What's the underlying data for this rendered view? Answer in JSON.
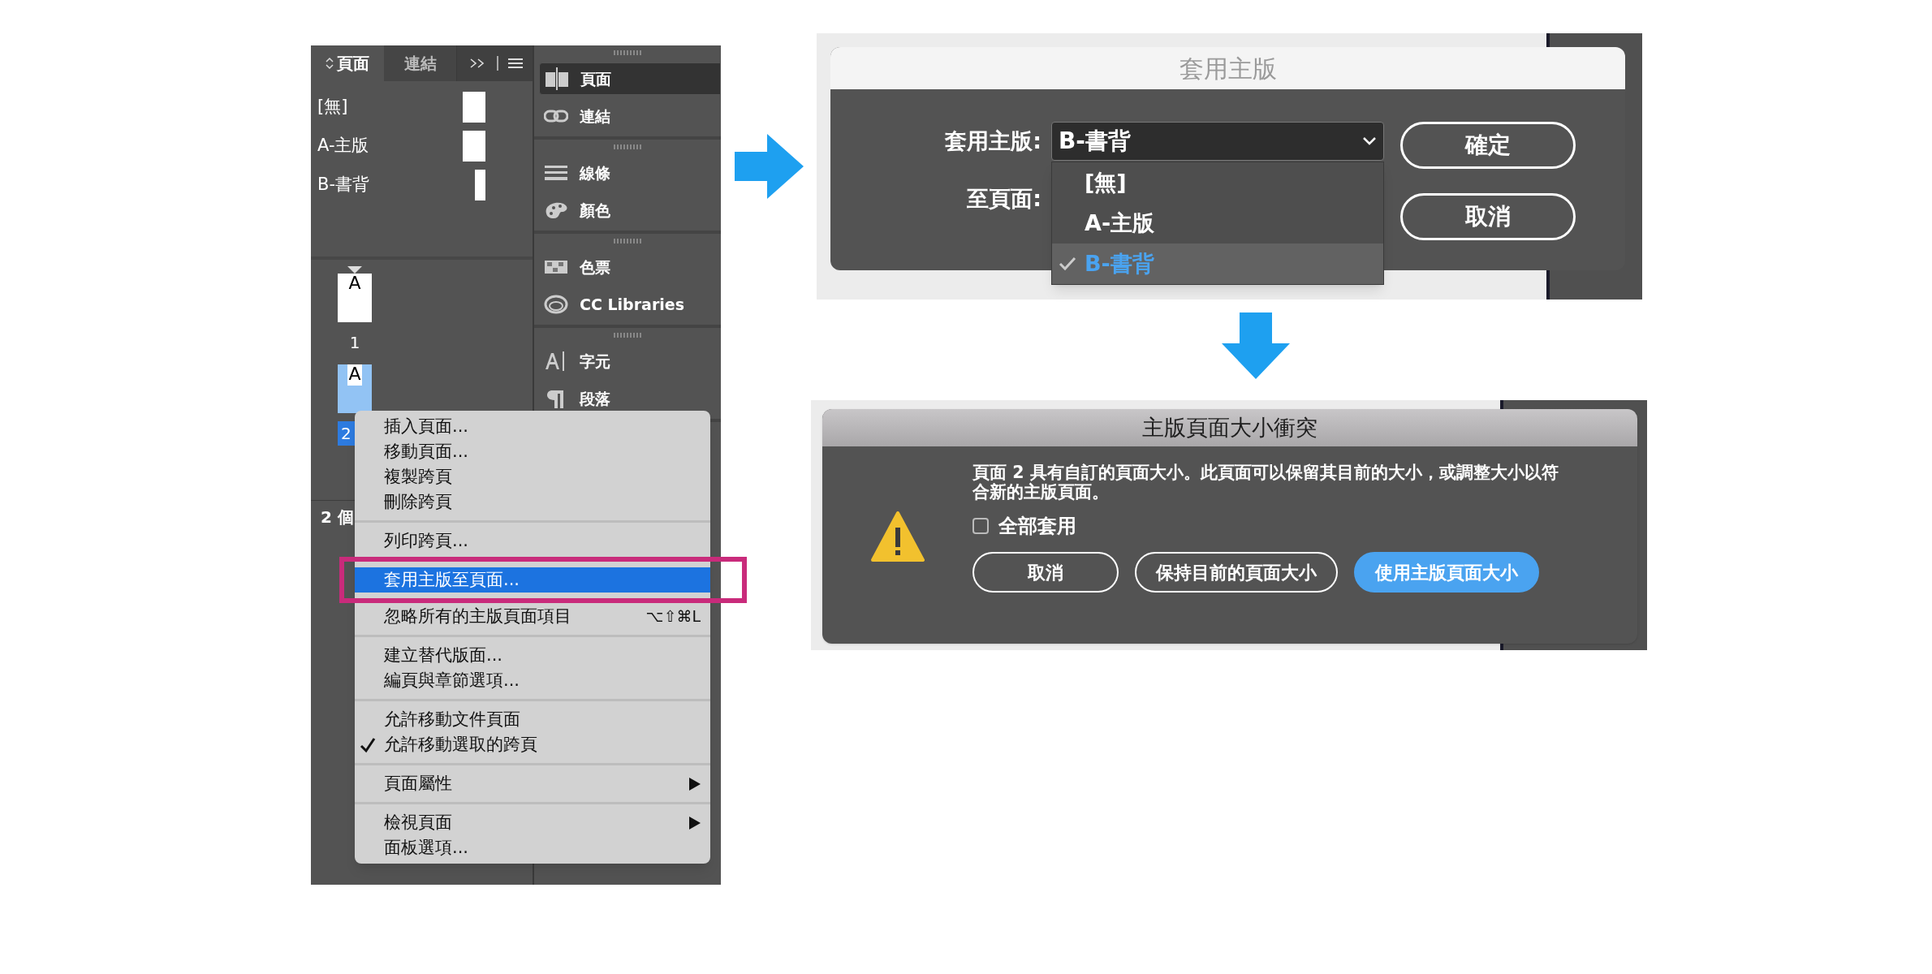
{
  "pages_panel": {
    "tabs": [
      {
        "label": "頁面",
        "selected": true
      },
      {
        "label": "連結",
        "selected": false
      }
    ],
    "masters": [
      {
        "label": "[無]",
        "kind": "page"
      },
      {
        "label": "A-主版",
        "kind": "page"
      },
      {
        "label": "B-書背",
        "kind": "spine"
      }
    ],
    "pages": [
      {
        "master": "A",
        "number": "1",
        "selected": false
      },
      {
        "master": "A",
        "number": "2",
        "selected": true
      }
    ],
    "status": "2 個"
  },
  "dock": {
    "groups": [
      [
        {
          "label": "頁面",
          "kind": "pages",
          "selected": true
        },
        {
          "label": "連結",
          "kind": "links",
          "selected": false
        }
      ],
      [
        {
          "label": "線條",
          "kind": "stroke",
          "selected": false
        },
        {
          "label": "顏色",
          "kind": "color",
          "selected": false
        }
      ],
      [
        {
          "label": "色票",
          "kind": "swatches",
          "selected": false
        },
        {
          "label": "CC Libraries",
          "kind": "cc",
          "selected": false
        }
      ],
      [
        {
          "label": "字元",
          "kind": "character",
          "selected": false
        },
        {
          "label": "段落",
          "kind": "paragraph",
          "selected": false
        }
      ]
    ]
  },
  "context_menu": {
    "sections": [
      [
        {
          "label": "插入頁面...",
          "checked": false,
          "submenu": false,
          "selected": false
        },
        {
          "label": "移動頁面...",
          "checked": false,
          "submenu": false,
          "selected": false
        },
        {
          "label": "複製跨頁",
          "checked": false,
          "submenu": false,
          "selected": false
        },
        {
          "label": "刪除跨頁",
          "checked": false,
          "submenu": false,
          "selected": false
        }
      ],
      [
        {
          "label": "列印跨頁...",
          "checked": false,
          "submenu": false,
          "selected": false
        }
      ],
      [
        {
          "label": "套用主版至頁面...",
          "checked": false,
          "submenu": false,
          "selected": true,
          "annotated": true
        },
        {
          "label": "忽略所有的主版頁面項目",
          "shortcut": "⌥⇧⌘L",
          "checked": false,
          "submenu": false,
          "selected": false
        }
      ],
      [
        {
          "label": "建立替代版面...",
          "checked": false,
          "submenu": false,
          "selected": false
        },
        {
          "label": "編頁與章節選項...",
          "checked": false,
          "submenu": false,
          "selected": false
        }
      ],
      [
        {
          "label": "允許移動文件頁面",
          "checked": false,
          "submenu": false,
          "selected": false
        },
        {
          "label": "允許移動選取的跨頁",
          "checked": true,
          "submenu": false,
          "selected": false
        }
      ],
      [
        {
          "label": "頁面屬性",
          "checked": false,
          "submenu": true,
          "selected": false
        }
      ],
      [
        {
          "label": "檢視頁面",
          "checked": false,
          "submenu": true,
          "selected": false
        },
        {
          "label": "面板選項...",
          "checked": false,
          "submenu": false,
          "selected": false
        }
      ]
    ]
  },
  "apply_master_dialog": {
    "title": "套用主版",
    "master_label": "套用主版:",
    "master_value": "B-書背",
    "pages_label": "至頁面:",
    "options": [
      {
        "label": "[無]",
        "selected": false
      },
      {
        "label": "A-主版",
        "selected": false
      },
      {
        "label": "B-書背",
        "selected": true
      }
    ],
    "buttons": [
      "確定",
      "取消"
    ]
  },
  "conflict_dialog": {
    "title": "主版頁面大小衝突",
    "message": "頁面 2 具有自訂的頁面大小。此頁面可以保留其目前的大小，或調整大小以符合新的主版頁面。",
    "checkbox": {
      "label": "全部套用",
      "checked": false
    },
    "buttons": [
      {
        "label": "取消",
        "primary": false
      },
      {
        "label": "保持目前的頁面大小",
        "primary": false
      },
      {
        "label": "使用主版頁面大小",
        "primary": true
      }
    ]
  }
}
